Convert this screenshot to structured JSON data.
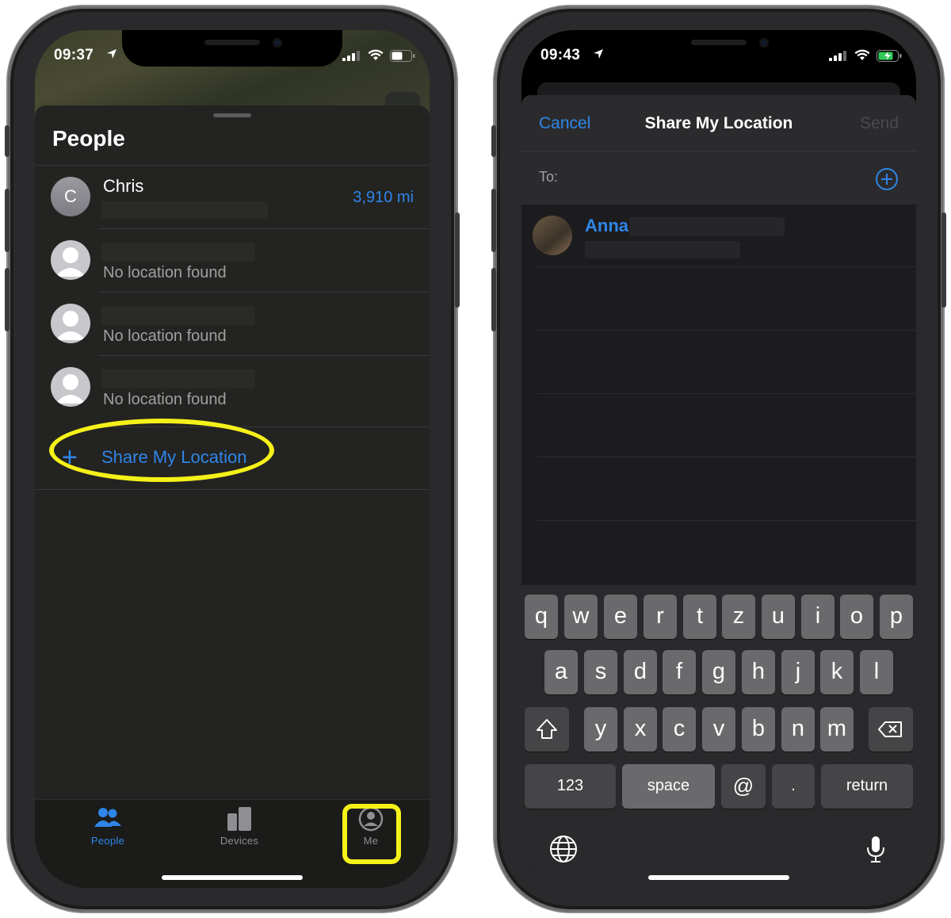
{
  "left_phone": {
    "status": {
      "time": "09:37"
    },
    "sheet_title": "People",
    "people": [
      {
        "initial": "C",
        "name": "Chris",
        "distance": "3,910 mi",
        "status": ""
      },
      {
        "initial": "",
        "name": "",
        "distance": "",
        "status": "No location found"
      },
      {
        "initial": "",
        "name": "",
        "distance": "",
        "status": "No location found"
      },
      {
        "initial": "",
        "name": "",
        "distance": "",
        "status": "No location found"
      }
    ],
    "share_action": {
      "icon": "+",
      "label": "Share My Location"
    },
    "tabs": [
      {
        "label": "People",
        "icon": "people-icon",
        "active": true
      },
      {
        "label": "Devices",
        "icon": "devices-icon",
        "active": false
      },
      {
        "label": "Me",
        "icon": "me-icon",
        "active": false
      }
    ],
    "highlight_color": "#f5f119",
    "accent_color": "#2f86e8"
  },
  "right_phone": {
    "status": {
      "time": "09:43"
    },
    "nav": {
      "cancel": "Cancel",
      "title": "Share My Location",
      "send": "Send"
    },
    "to_label": "To:",
    "contact": {
      "name": "Anna"
    },
    "keyboard": {
      "row1": [
        "q",
        "w",
        "e",
        "r",
        "t",
        "z",
        "u",
        "i",
        "o",
        "p"
      ],
      "row2": [
        "a",
        "s",
        "d",
        "f",
        "g",
        "h",
        "j",
        "k",
        "l"
      ],
      "row3": [
        "y",
        "x",
        "c",
        "v",
        "b",
        "n",
        "m"
      ],
      "row4": {
        "numbers": "123",
        "space": "space",
        "at": "@",
        "dot": ".",
        "return": "return"
      }
    }
  }
}
